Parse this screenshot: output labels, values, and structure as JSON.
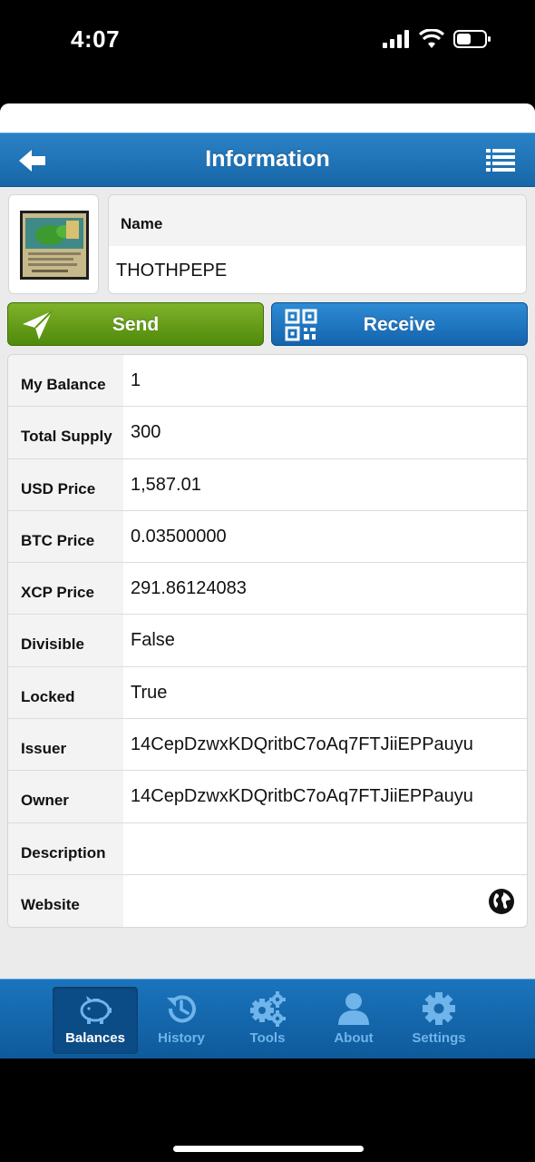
{
  "status_bar": {
    "time": "4:07"
  },
  "navbar": {
    "title": "Information"
  },
  "asset": {
    "name_label": "Name",
    "name": "THOTHPEPE"
  },
  "actions": {
    "send_label": "Send",
    "receive_label": "Receive"
  },
  "info": [
    {
      "label": "My Balance",
      "value": "1"
    },
    {
      "label": "Total Supply",
      "value": "300"
    },
    {
      "label": "USD Price",
      "value": "1,587.01"
    },
    {
      "label": "BTC Price",
      "value": "0.03500000"
    },
    {
      "label": "XCP Price",
      "value": "291.86124083"
    },
    {
      "label": "Divisible",
      "value": "False"
    },
    {
      "label": "Locked",
      "value": "True"
    },
    {
      "label": "Issuer",
      "value": "14CepDzwxKDQritbC7oAq7FTJiiEPPauyu"
    },
    {
      "label": "Owner",
      "value": "14CepDzwxKDQritbC7oAq7FTJiiEPPauyu"
    },
    {
      "label": "Description",
      "value": ""
    },
    {
      "label": "Website",
      "value": "",
      "icon": "globe-icon"
    }
  ],
  "tabs": [
    {
      "label": "Balances",
      "icon": "piggy-bank-icon",
      "active": true
    },
    {
      "label": "History",
      "icon": "history-icon",
      "active": false
    },
    {
      "label": "Tools",
      "icon": "gears-icon",
      "active": false
    },
    {
      "label": "About",
      "icon": "user-icon",
      "active": false
    },
    {
      "label": "Settings",
      "icon": "gear-icon",
      "active": false
    }
  ],
  "colors": {
    "nav_blue": "#1767a8",
    "send_green": "#5f9a14",
    "receive_blue": "#1a72bf",
    "tab_inactive": "#6fb4ea"
  }
}
